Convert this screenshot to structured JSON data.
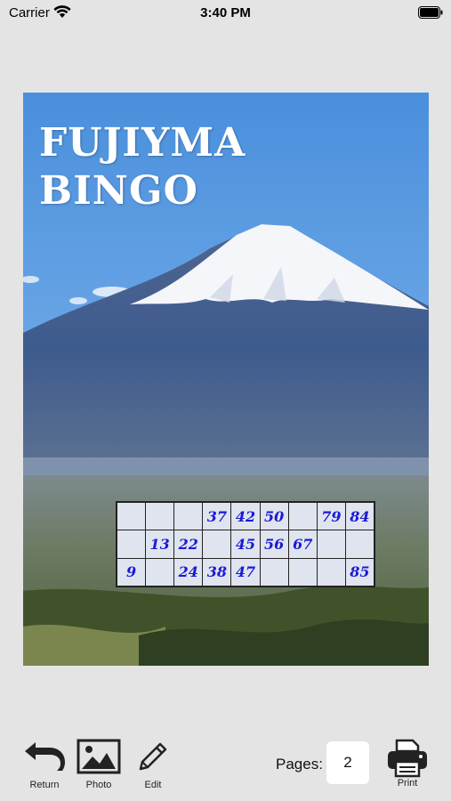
{
  "status_bar": {
    "carrier": "Carrier",
    "time": "3:40 PM"
  },
  "card": {
    "title_lines": [
      "FUJIYMA",
      "BINGO"
    ],
    "bingo_rows": [
      [
        "",
        "",
        "",
        "37",
        "42",
        "50",
        "",
        "79",
        "84"
      ],
      [
        "",
        "13",
        "22",
        "",
        "45",
        "56",
        "67",
        "",
        ""
      ],
      [
        "9",
        "",
        "24",
        "38",
        "47",
        "",
        "",
        "",
        "85"
      ]
    ],
    "number_color": "#1a1ad6"
  },
  "toolbar": {
    "return_label": "Return",
    "photo_label": "Photo",
    "edit_label": "Edit",
    "pages_label": "Pages:",
    "pages_value": "2",
    "print_label": "Print"
  }
}
